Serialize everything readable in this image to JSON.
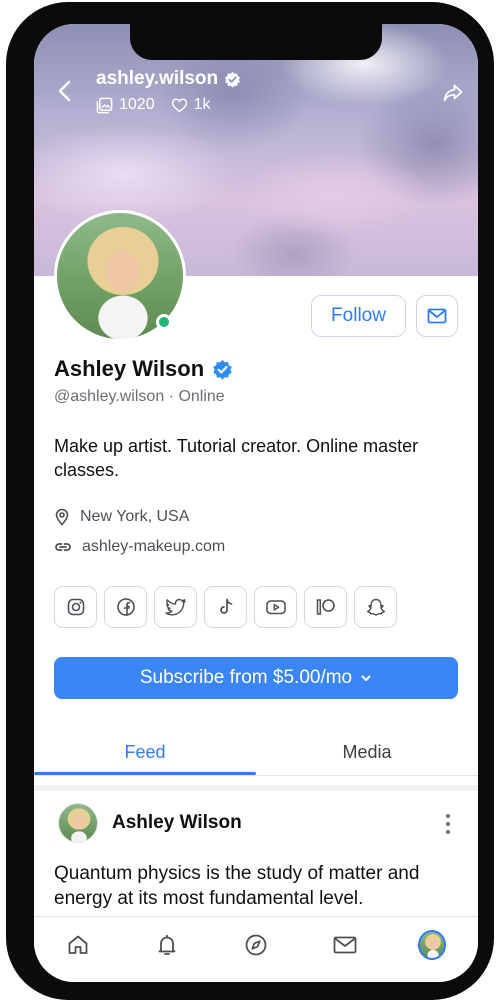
{
  "cover": {
    "username": "ashley.wilson",
    "posts_count": "1020",
    "likes_count": "1k"
  },
  "profile": {
    "display_name": "Ashley Wilson",
    "handle": "@ashley.wilson",
    "status": "Online",
    "bio": "Make up artist. Tutorial creator. Online master classes.",
    "location": "New York, USA",
    "website": "ashley-makeup.com",
    "online_color": "#22b573"
  },
  "actions": {
    "follow_label": "Follow",
    "subscribe_label": "Subscribe from $5.00/mo"
  },
  "socials": [
    "instagram-icon",
    "facebook-icon",
    "twitter-icon",
    "tiktok-icon",
    "youtube-icon",
    "patreon-icon",
    "snapchat-icon"
  ],
  "tabs": {
    "feed": "Feed",
    "media": "Media",
    "active": "Feed"
  },
  "post": {
    "author": "Ashley Wilson",
    "text": "Quantum physics is the study of matter and energy at its most fundamental level."
  },
  "bottom_nav": [
    "home-icon",
    "bell-icon",
    "compass-icon",
    "mail-icon",
    "profile-avatar"
  ],
  "colors": {
    "accent": "#2f7cf6",
    "subscribe_bg": "#3a86f7"
  }
}
